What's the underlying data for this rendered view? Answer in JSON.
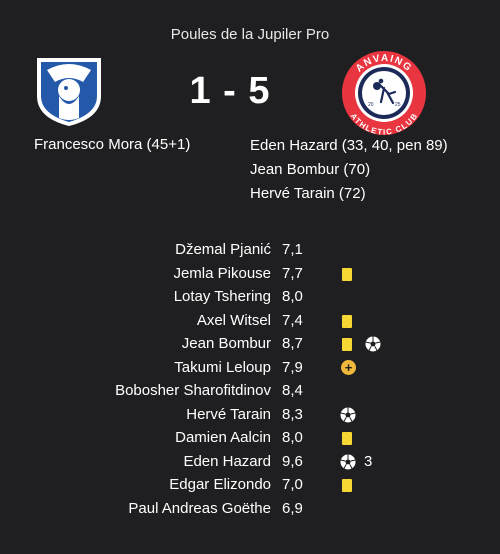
{
  "match": {
    "competition": "Poules de la Jupiler Pro",
    "score": "1 - 5",
    "away_badge": {
      "top_text": "ANVAING",
      "bottom_text": "ATHLETIC CLUB",
      "year_left": "20",
      "year_right": "25"
    }
  },
  "home_scorers": [
    "Francesco Mora (45+1)"
  ],
  "away_scorers": [
    "Eden Hazard (33, 40, pen 89)",
    "Jean Bombur (70)",
    "Hervé Tarain (72)"
  ],
  "players": [
    {
      "name": "Džemal Pjanić",
      "rating": "7,1",
      "events": []
    },
    {
      "name": "Jemla Pikouse",
      "rating": "7,7",
      "events": [
        "yellow-card"
      ]
    },
    {
      "name": "Lotay Tshering",
      "rating": "8,0",
      "events": []
    },
    {
      "name": "Axel Witsel",
      "rating": "7,4",
      "events": [
        "yellow-card"
      ]
    },
    {
      "name": "Jean Bombur",
      "rating": "8,7",
      "events": [
        "yellow-card",
        "goal"
      ]
    },
    {
      "name": "Takumi Leloup",
      "rating": "7,9",
      "events": [
        "substitution"
      ]
    },
    {
      "name": "Bobosher Sharofitdinov",
      "rating": "8,4",
      "events": []
    },
    {
      "name": "Hervé Tarain",
      "rating": "8,3",
      "events": [
        "goal"
      ]
    },
    {
      "name": "Damien Aalcin",
      "rating": "8,0",
      "events": [
        "yellow-card"
      ]
    },
    {
      "name": "Eden Hazard",
      "rating": "9,6",
      "events": [
        "goal"
      ],
      "goal_count": "3"
    },
    {
      "name": "Edgar Elizondo",
      "rating": "7,0",
      "events": [
        "yellow-card"
      ]
    },
    {
      "name": "Paul Andreas Goëthe",
      "rating": "6,9",
      "events": []
    }
  ],
  "icons": {
    "yellow_card_color": "#f7d733",
    "substitution_color": "#f0b73a",
    "substitution_glyph": "+"
  }
}
